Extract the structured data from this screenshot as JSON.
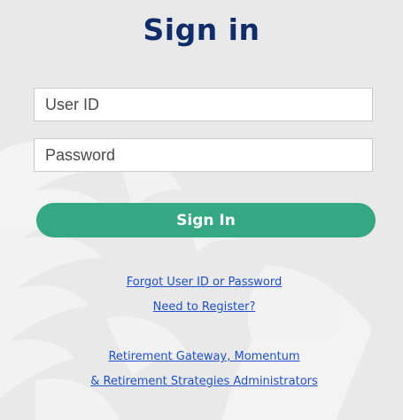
{
  "title": "Sign in",
  "form": {
    "userid_placeholder": "User ID",
    "password_placeholder": "Password",
    "signin_label": "Sign In"
  },
  "links": {
    "forgot": "Forgot User ID or Password",
    "register": "Need to Register?",
    "gateway_line1": "Retirement Gateway, Momentum",
    "gateway_line2": "& Retirement Strategies Administrators"
  },
  "colors": {
    "background": "#e9e9e9",
    "title": "#0f2c6b",
    "button": "#34a882",
    "link": "#1d4fd0"
  },
  "icons": {
    "watermark": "lion-head-watermark"
  }
}
